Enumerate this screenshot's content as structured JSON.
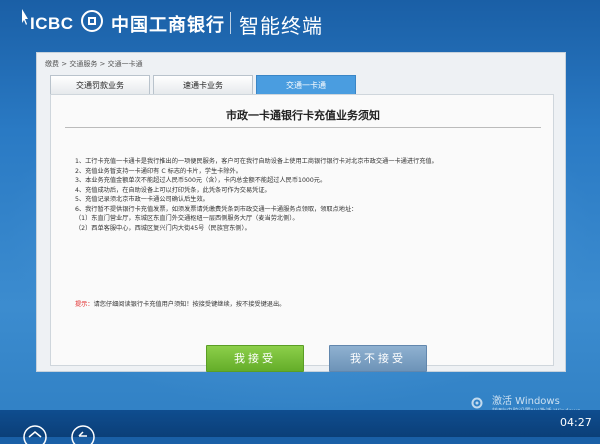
{
  "header": {
    "logo_text": "ICBC",
    "bank_name": "中国工商银行",
    "terminal_name": "智能终端"
  },
  "breadcrumb": "缴费 > 交通服务 > 交通一卡通",
  "tabs": [
    {
      "label": "交通罚款业务",
      "active": false
    },
    {
      "label": "速通卡业务",
      "active": false
    },
    {
      "label": "交通一卡通",
      "active": true
    }
  ],
  "notice": {
    "title": "市政一卡通银行卡充值业务须知",
    "lines": [
      "1、工行卡充值一卡通卡是我行推出的一项便民服务，客户可在我行自助设备上使用工商银行银行卡对北京市政交通一卡通进行充值。",
      "2、充值业务暂支持一卡通印有 C 标志的卡片，学生卡除外。",
      "3、本业务充值金额单次不能超过人民币500元（含），卡内总金额不能超过人民币1000元。",
      "4、充值成功后，在自助设备上可以打印凭条，此凭条可作为交易凭证。",
      "5、充值记录须北京市政一卡通公司确认后生效。",
      "6、我行暂不提供银行卡充值发票，如须发票请凭缴费凭条到市政交通一卡通服务点领取，领取点地址：",
      "（1）东直门营业厅，东城区东直门外交通枢纽一层西侧服务大厅（麦当劳北侧）。",
      "（2）西单客服中心，西城区复兴门内大街45号（民族宫东侧）。"
    ],
    "hint_label": "提示：",
    "hint_text": "请您仔细阅读银行卡充值用户须知！按接受键继续，按不接受键退出。"
  },
  "buttons": {
    "accept": "我接受",
    "reject": "我不接受"
  },
  "watermark": {
    "title": "激活 Windows",
    "subtitle": "转到\"电脑设置\"以激活 Windows。"
  },
  "clock": "04:27",
  "colors": {
    "accent": "#4a9de0",
    "accept_button": "#72b832",
    "reject_button": "#7ea2c5",
    "hint_red": "#e02020"
  }
}
